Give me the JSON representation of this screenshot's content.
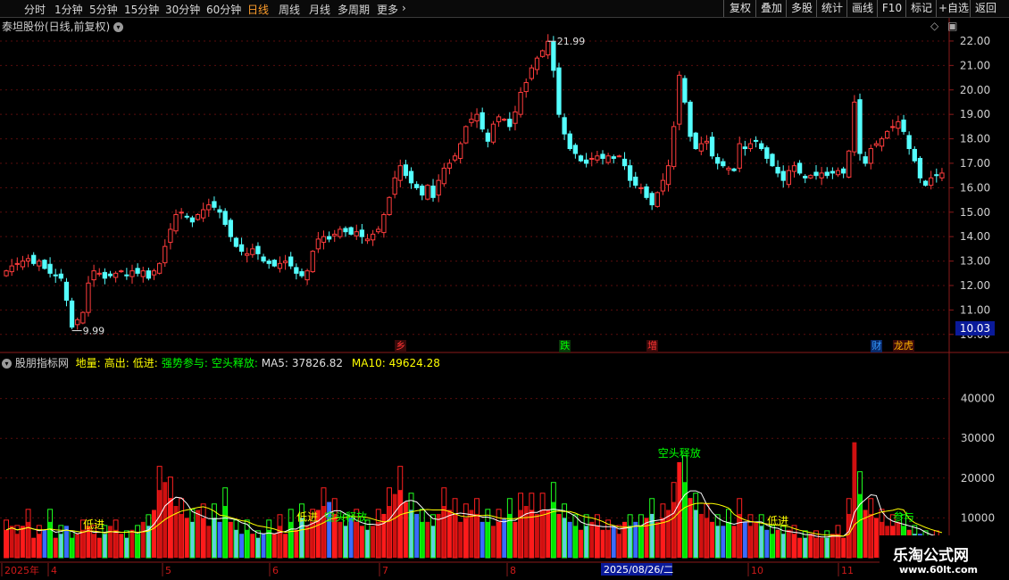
{
  "toolbar": {
    "periods": [
      "分时",
      "1分钟",
      "5分钟",
      "15分钟",
      "30分钟",
      "60分钟",
      "日线",
      "周线",
      "月线",
      "多周期",
      "更多"
    ],
    "active": "日线",
    "right_buttons": [
      "复权",
      "叠加",
      "多股",
      "统计",
      "画线",
      "F10",
      "标记",
      "+自选",
      "返回"
    ]
  },
  "stock_title": "泰坦股份(日线,前复权)",
  "indicator": {
    "name": "股朋指标网",
    "legend": [
      {
        "label": "地量:",
        "color": "#ffff00"
      },
      {
        "label": "高出:",
        "color": "#ffff00"
      },
      {
        "label": "低进:",
        "color": "#ffff00"
      },
      {
        "label": "强势参与:",
        "color": "#00ff00"
      },
      {
        "label": "空头释放:",
        "color": "#00ff00"
      }
    ],
    "ma5_label": "MA5:",
    "ma5_value": "37826.82",
    "ma10_label": "MA10:",
    "ma10_value": "49624.28"
  },
  "price_axis_labels": [
    "22.00",
    "21.00",
    "20.00",
    "19.00",
    "18.00",
    "17.00",
    "16.00",
    "15.00",
    "14.00",
    "13.00",
    "12.00",
    "11.00",
    "10.00"
  ],
  "current_price": "10.03",
  "high_mark": "21.99",
  "low_mark": "9.99",
  "volume_axis_labels": [
    "40000",
    "30000",
    "20000",
    "10000"
  ],
  "date_axis": [
    "2025年",
    "4",
    "5",
    "6",
    "7",
    "8",
    "10",
    "11"
  ],
  "date_highlight": "2025/08/26/二",
  "event_markers": [
    {
      "text": "乡",
      "color": "#ff3333",
      "idx": 72
    },
    {
      "text": "跌",
      "color": "#00ff00",
      "idx": 102
    },
    {
      "text": "增",
      "color": "#ff3333",
      "idx": 118
    },
    {
      "text": "财",
      "color": "#3399ff",
      "idx": 159
    },
    {
      "text": "龙虎",
      "color": "#ffb000",
      "idx": 163
    }
  ],
  "volume_labels": [
    {
      "text": "低进",
      "color": "#ffff00",
      "idx": 16
    },
    {
      "text": "空头释放",
      "color": "#00ff00",
      "idx": 62
    },
    {
      "text": "低进",
      "color": "#ffff00",
      "idx": 55
    },
    {
      "text": "空头释放",
      "color": "#00ff00",
      "idx": 123
    },
    {
      "text": "低进",
      "color": "#ffff00",
      "idx": 141
    },
    {
      "text": "参与",
      "color": "#00ff00",
      "idx": 164
    }
  ],
  "watermark": {
    "line1": "乐淘公式网",
    "line2": "www.60lt.com"
  },
  "chart_data": {
    "type": "candlestick",
    "ylim": [
      9.7,
      22.4
    ],
    "vol_ylim": [
      0,
      50000
    ],
    "closes": [
      12.6,
      12.8,
      12.9,
      13.0,
      13.1,
      12.9,
      13.0,
      12.7,
      12.5,
      12.4,
      12.3,
      11.4,
      10.3,
      10.6,
      10.9,
      12.1,
      12.6,
      12.5,
      12.3,
      12.4,
      12.5,
      12.6,
      12.4,
      12.6,
      12.5,
      12.6,
      12.3,
      12.6,
      12.9,
      13.6,
      14.3,
      14.9,
      15.0,
      14.8,
      14.6,
      14.9,
      15.1,
      15.3,
      15.2,
      15.0,
      14.5,
      14.0,
      13.6,
      13.4,
      13.3,
      13.5,
      13.3,
      13.0,
      12.9,
      12.8,
      12.9,
      13.0,
      12.8,
      12.5,
      12.4,
      12.6,
      13.4,
      13.9,
      14.0,
      13.9,
      14.1,
      14.3,
      14.2,
      14.1,
      14.2,
      14.0,
      13.9,
      14.1,
      14.3,
      14.9,
      15.6,
      16.4,
      16.9,
      16.5,
      16.2,
      16.0,
      15.7,
      16.1,
      15.6,
      16.3,
      16.8,
      17.0,
      17.3,
      17.8,
      18.5,
      18.8,
      19.0,
      18.4,
      17.9,
      18.6,
      18.9,
      18.8,
      18.5,
      19.1,
      19.9,
      20.3,
      20.9,
      21.3,
      21.6,
      21.99,
      20.8,
      19.0,
      18.2,
      17.6,
      17.4,
      17.1,
      17.0,
      17.2,
      17.3,
      17.2,
      17.3,
      17.2,
      17.3,
      16.9,
      16.3,
      16.1,
      16.0,
      15.6,
      15.3,
      15.8,
      16.3,
      16.9,
      18.5,
      20.6,
      19.5,
      18.1,
      17.6,
      17.8,
      17.9,
      17.3,
      17.0,
      16.9,
      16.8,
      16.7,
      17.8,
      17.6,
      17.8,
      17.9,
      17.6,
      17.2,
      16.9,
      16.6,
      16.3,
      16.7,
      16.9,
      16.6,
      16.4,
      16.5,
      16.5,
      16.6,
      16.5,
      16.6,
      16.7,
      16.6,
      17.5,
      19.5,
      17.4,
      17.0,
      17.6,
      17.8,
      18.0,
      18.3,
      18.5,
      18.7,
      18.3,
      17.6,
      17.1,
      16.4,
      16.1,
      16.4,
      16.5,
      16.6
    ],
    "volumes": [
      7000,
      8000,
      6000,
      8000,
      9000,
      5000,
      6000,
      7000,
      9000,
      5000,
      6000,
      8000,
      5000,
      6000,
      7000,
      8000,
      6000,
      5000,
      6000,
      8000,
      7000,
      6000,
      5000,
      7000,
      6000,
      9000,
      8000,
      12000,
      17000,
      19000,
      15000,
      13000,
      11000,
      10000,
      9000,
      12000,
      10000,
      8000,
      10000,
      9000,
      13000,
      9000,
      7000,
      6000,
      7000,
      6000,
      5000,
      6000,
      7000,
      6000,
      8000,
      6000,
      9000,
      7000,
      10000,
      8000,
      9000,
      12000,
      13000,
      14000,
      11000,
      9000,
      8000,
      10000,
      9000,
      8000,
      7000,
      8000,
      9000,
      11000,
      13000,
      16000,
      17000,
      14000,
      12000,
      11000,
      9000,
      9000,
      8000,
      11000,
      13000,
      12000,
      11000,
      9000,
      10000,
      12000,
      11000,
      9000,
      9000,
      8000,
      9000,
      10000,
      11000,
      9000,
      12000,
      13000,
      12000,
      11000,
      12000,
      12000,
      14000,
      11000,
      10000,
      9000,
      8000,
      7000,
      8000,
      9000,
      8000,
      7000,
      7000,
      8000,
      6000,
      9000,
      8000,
      9000,
      8000,
      10000,
      11000,
      9000,
      10000,
      12000,
      14000,
      24000,
      19000,
      15000,
      12000,
      11000,
      10000,
      9000,
      8000,
      8000,
      9000,
      8000,
      11000,
      9000,
      8000,
      9000,
      8000,
      7000,
      6000,
      7000,
      6000,
      7000,
      6000,
      5000,
      5000,
      6000,
      5000,
      5000,
      5000,
      6000,
      6000,
      5000,
      11000,
      29000,
      16000,
      12000,
      11000,
      10000,
      9000,
      8000,
      8000,
      9000,
      8000,
      7000,
      6000,
      6000,
      5000,
      5000,
      5000,
      4000
    ]
  }
}
